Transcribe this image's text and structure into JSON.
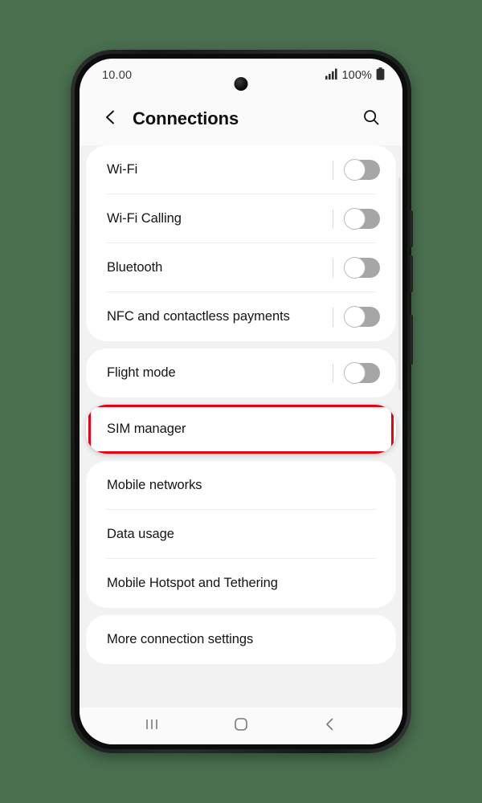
{
  "status_bar": {
    "time": "10.00",
    "battery_percent": "100%",
    "signal_icon": "signal-bars-icon",
    "battery_icon": "battery-full-icon"
  },
  "app_bar": {
    "title": "Connections",
    "back_icon": "chevron-left-icon",
    "search_icon": "search-icon"
  },
  "groups": [
    {
      "rows": [
        {
          "label": "Wi-Fi",
          "type": "toggle",
          "toggle_state": "off"
        },
        {
          "label": "Wi-Fi Calling",
          "type": "toggle",
          "toggle_state": "off"
        },
        {
          "label": "Bluetooth",
          "type": "toggle",
          "toggle_state": "off"
        },
        {
          "label": "NFC and contactless payments",
          "type": "toggle",
          "toggle_state": "off"
        }
      ]
    },
    {
      "rows": [
        {
          "label": "Flight mode",
          "type": "toggle",
          "toggle_state": "off"
        }
      ]
    },
    {
      "highlighted": true,
      "rows": [
        {
          "label": "SIM manager",
          "type": "link"
        }
      ]
    },
    {
      "rows": [
        {
          "label": "Mobile networks",
          "type": "link"
        },
        {
          "label": "Data usage",
          "type": "link"
        },
        {
          "label": "Mobile Hotspot and Tethering",
          "type": "link"
        }
      ]
    },
    {
      "rows": [
        {
          "label": "More connection settings",
          "type": "link"
        }
      ]
    }
  ],
  "nav_bar": {
    "recents_label": "|||",
    "recents_icon": "recents-icon",
    "home_icon": "home-icon",
    "back_icon": "back-icon"
  },
  "colors": {
    "page_background": "#4a7050",
    "highlight_red": "#ea0011",
    "card_white": "#ffffff",
    "list_background": "#f2f2f2",
    "toggle_off_track": "#a6a6a6"
  }
}
